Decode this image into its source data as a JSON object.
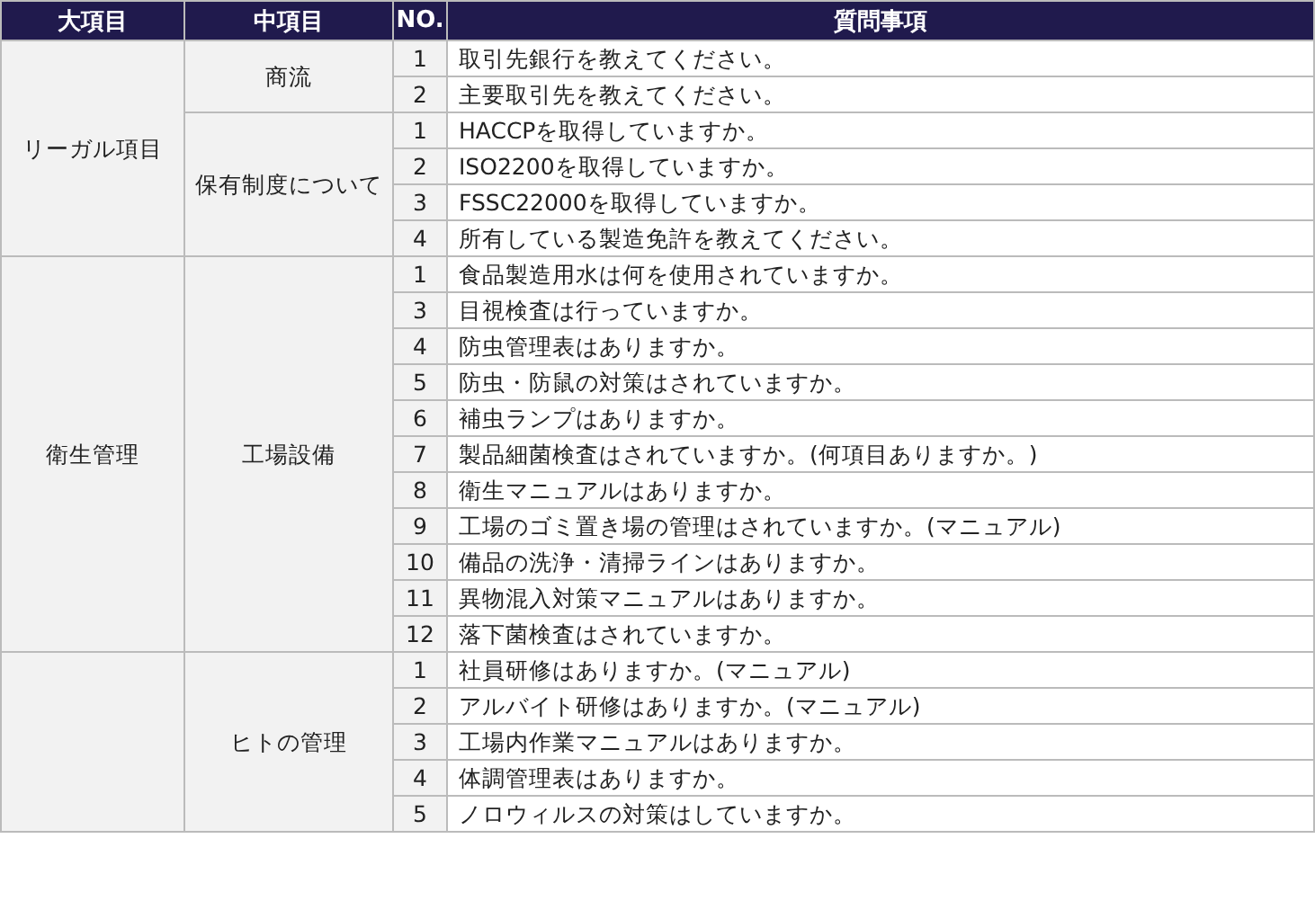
{
  "columns": [
    "大項目",
    "中項目",
    "NO.",
    "質問事項"
  ],
  "groups": [
    {
      "major": "リーガル項目",
      "subs": [
        {
          "name": "商流",
          "items": [
            {
              "no": "1",
              "question": "取引先銀行を教えてください。"
            },
            {
              "no": "2",
              "question": "主要取引先を教えてください。"
            }
          ]
        },
        {
          "name": "保有制度について",
          "items": [
            {
              "no": "1",
              "question": "HACCPを取得していますか。"
            },
            {
              "no": "2",
              "question": "ISO2200を取得していますか。"
            },
            {
              "no": "3",
              "question": "FSSC22000を取得していますか。"
            },
            {
              "no": "4",
              "question": "所有している製造免許を教えてください。"
            }
          ]
        }
      ]
    },
    {
      "major": "衛生管理",
      "subs": [
        {
          "name": "工場設備",
          "items": [
            {
              "no": "1",
              "question": "食品製造用水は何を使用されていますか。"
            },
            {
              "no": "3",
              "question": "目視検査は行っていますか。"
            },
            {
              "no": "4",
              "question": "防虫管理表はありますか。"
            },
            {
              "no": "5",
              "question": "防虫・防鼠の対策はされていますか。"
            },
            {
              "no": "6",
              "question": "補虫ランプはありますか。"
            },
            {
              "no": "7",
              "question": "製品細菌検査はされていますか。(何項目ありますか。)"
            },
            {
              "no": "8",
              "question": "衛生マニュアルはありますか。"
            },
            {
              "no": "9",
              "question": "工場のゴミ置き場の管理はされていますか。(マニュアル)"
            },
            {
              "no": "10",
              "question": "備品の洗浄・清掃ラインはありますか。"
            },
            {
              "no": "11",
              "question": "異物混入対策マニュアルはありますか。"
            },
            {
              "no": "12",
              "question": "落下菌検査はされていますか。"
            }
          ]
        }
      ]
    },
    {
      "subs": [
        {
          "name": "ヒトの管理",
          "items": [
            {
              "no": "1",
              "question": "社員研修はありますか。(マニュアル)"
            },
            {
              "no": "2",
              "question": "アルバイト研修はありますか。(マニュアル)"
            },
            {
              "no": "3",
              "question": "工場内作業マニュアルはありますか。"
            },
            {
              "no": "4",
              "question": "体調管理表はありますか。"
            },
            {
              "no": "5",
              "question": "ノロウィルスの対策はしていますか。"
            }
          ]
        }
      ]
    }
  ]
}
